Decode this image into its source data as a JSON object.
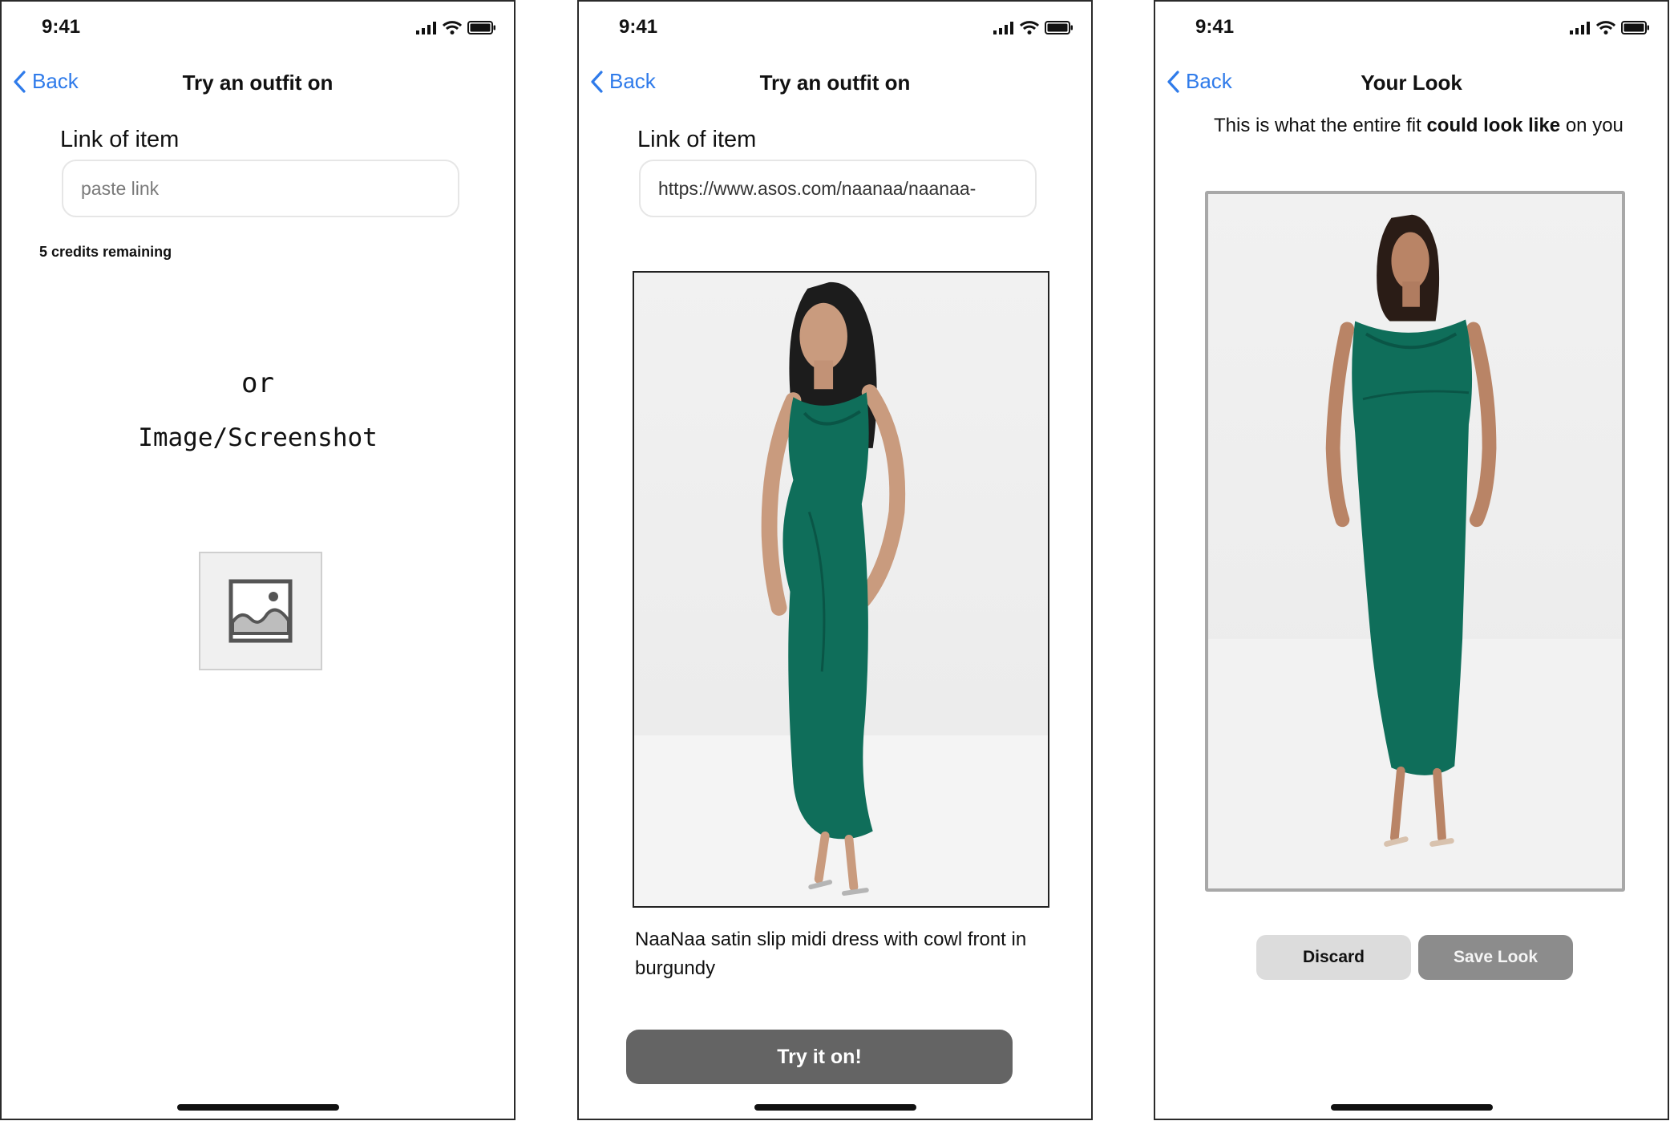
{
  "screens": [
    {
      "status_time": "9:41",
      "back_label": "Back",
      "title": "Try an outfit on",
      "link_label": "Link of item",
      "link_placeholder": "paste link",
      "credits": "5 credits remaining",
      "or_text": "or",
      "upload_label": "Image/Screenshot"
    },
    {
      "status_time": "9:41",
      "back_label": "Back",
      "title": "Try an outfit on",
      "link_label": "Link of item",
      "link_value": "https://www.asos.com/naanaa/naanaa-",
      "product_title": "NaaNaa satin slip midi dress with cowl front in burgundy",
      "try_button": "Try it on!"
    },
    {
      "status_time": "9:41",
      "back_label": "Back",
      "title": "Your Look",
      "desc_pre": "This is what the entire fit ",
      "desc_bold": "could look like",
      "desc_post": " on you",
      "discard_button": "Discard",
      "save_button": "Save Look"
    }
  ],
  "icons": {
    "back": "chevron-left-icon",
    "signal": "cellular-signal-icon",
    "wifi": "wifi-icon",
    "battery": "battery-icon",
    "image_placeholder": "image-icon"
  },
  "colors": {
    "accent": "#2f7bea",
    "dress": "#0f6e5a",
    "primary_button": "#646464",
    "save_button": "#8c8c8c",
    "discard_button": "#dcdcdc"
  }
}
